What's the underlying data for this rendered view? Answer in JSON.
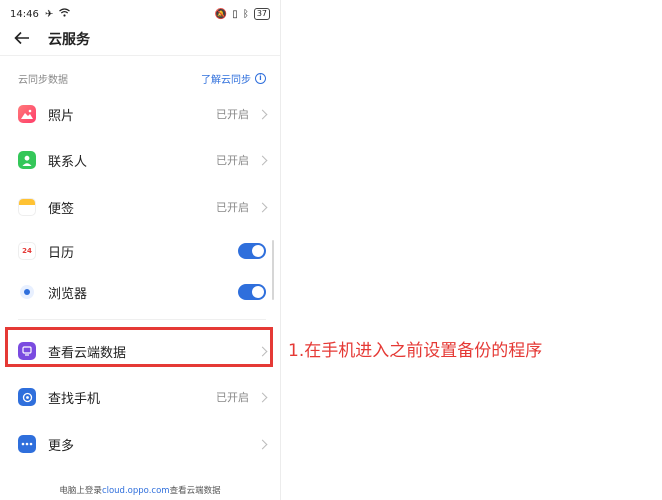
{
  "status_bar": {
    "time": "14:46",
    "battery": "37"
  },
  "app_bar": {
    "title": "云服务"
  },
  "section": {
    "label": "云同步数据",
    "link": "了解云同步"
  },
  "rows": [
    {
      "label": "照片",
      "status": "已开启",
      "icon": "photos-icon",
      "color": "#ff5a5f"
    },
    {
      "label": "联系人",
      "status": "已开启",
      "icon": "contacts-icon",
      "color": "#34c759"
    },
    {
      "label": "便签",
      "status": "已开启",
      "icon": "notes-icon",
      "color": "#ffc233"
    },
    {
      "label": "日历",
      "icon": "calendar-icon",
      "calendar_day": "24",
      "toggle_on": true
    },
    {
      "label": "浏览器",
      "icon": "browser-icon",
      "color": "#2f6fdc",
      "toggle_on": true
    },
    {
      "label": "查看云端数据",
      "icon": "cloud-data-icon",
      "color": "#7a4be0"
    },
    {
      "label": "查找手机",
      "status": "已开启",
      "icon": "find-phone-icon",
      "color": "#2f6fdc"
    },
    {
      "label": "更多",
      "icon": "more-icon",
      "color": "#2f6fdc"
    }
  ],
  "footer": {
    "prefix": "电脑上登录",
    "domain": "cloud.oppo.com",
    "suffix": "查看云端数据"
  },
  "annotation": "1.在手机进入之前设置备份的程序",
  "colors": {
    "accent": "#2f6fdc",
    "highlight": "#e53935"
  }
}
